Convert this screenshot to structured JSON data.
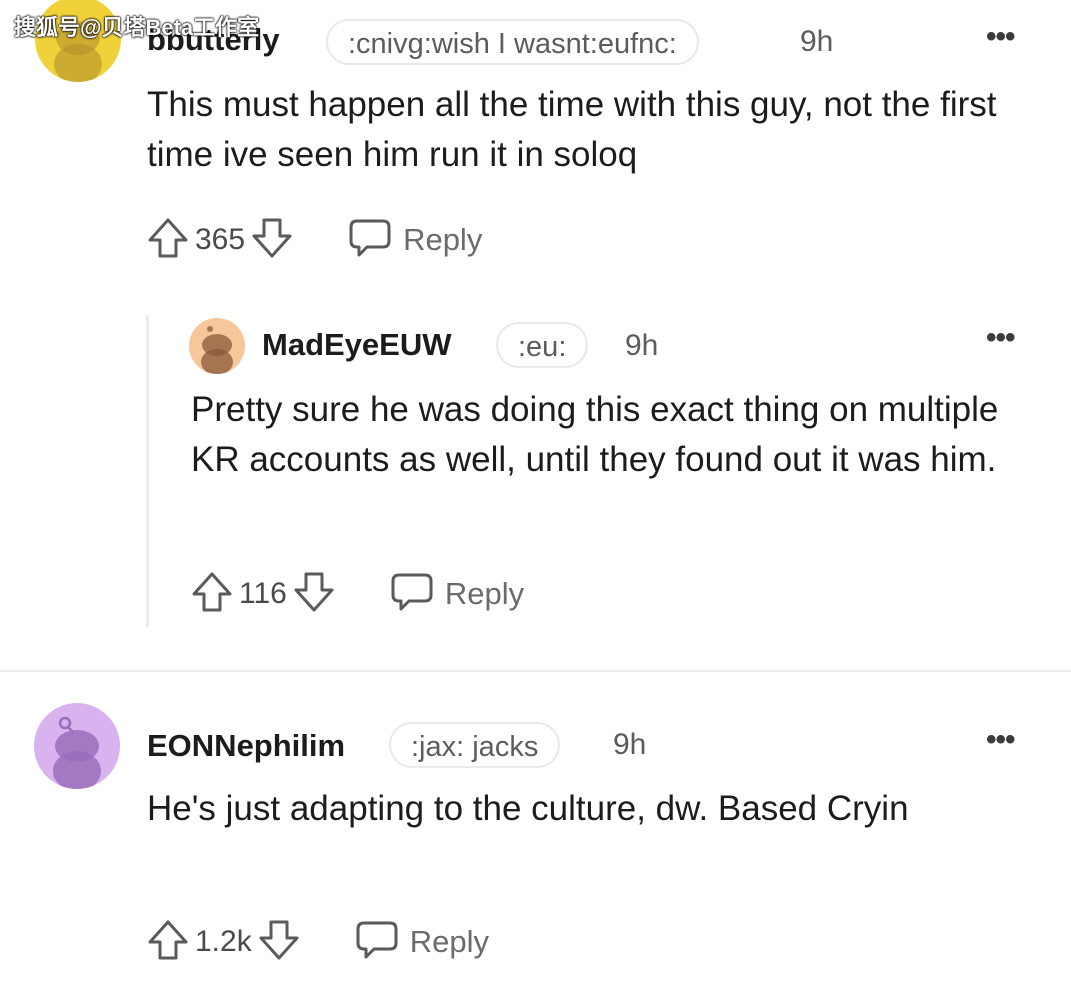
{
  "watermark": "搜狐号@贝塔Beta工作室",
  "comments": [
    {
      "username": "bbutterly",
      "flair": ":cnivg:wish I wasnt:eufnc:",
      "time": "9h",
      "body": "This must happen all the time with this guy, not the first time ive seen him run it in soloq",
      "score": "365",
      "reply_label": "Reply",
      "avatar_color": "#f0d13a"
    },
    {
      "username": "MadEyeEUW",
      "flair": ":eu:",
      "time": "9h",
      "body": "Pretty sure he was doing this exact thing on multiple KR accounts as well, until they found out it was him.",
      "score": "116",
      "reply_label": "Reply",
      "avatar_color": "#f6c79a"
    },
    {
      "username": "EONNephilim",
      "flair": ":jax: jacks",
      "time": "9h",
      "body": "He's just adapting to the culture, dw. Based Cryin",
      "score": "1.2k",
      "reply_label": "Reply",
      "avatar_color": "#d9b2f0"
    }
  ],
  "icons": {
    "upvote": "upvote-arrow-icon",
    "downvote": "downvote-arrow-icon",
    "reply": "speech-bubble-icon",
    "more": "more-options-icon"
  }
}
